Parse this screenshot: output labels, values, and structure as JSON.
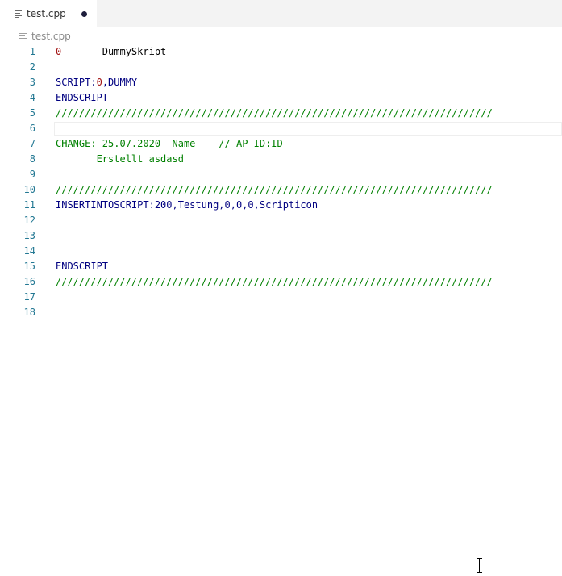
{
  "tab": {
    "label": "test.cpp",
    "file_icon": "file-lines-icon",
    "dirty_indicator": "unsaved-dot"
  },
  "breadcrumb": {
    "label": "test.cpp",
    "icon": "file-lines-icon"
  },
  "colors": {
    "line_number": "#237893",
    "keyword": "#000080",
    "comment": "#008000",
    "number": "#a31515"
  },
  "editor": {
    "current_line": 6,
    "lines": [
      {
        "n": "1",
        "tokens": [
          {
            "t": "0",
            "c": "num"
          },
          {
            "t": "       DummySkript",
            "c": "plain"
          }
        ]
      },
      {
        "n": "2",
        "tokens": []
      },
      {
        "n": "3",
        "tokens": [
          {
            "t": "SCRIPT:",
            "c": "kw"
          },
          {
            "t": "0",
            "c": "num"
          },
          {
            "t": ",DUMMY",
            "c": "kw"
          }
        ]
      },
      {
        "n": "4",
        "tokens": [
          {
            "t": "ENDSCRIPT",
            "c": "kw"
          }
        ]
      },
      {
        "n": "5",
        "tokens": [
          {
            "t": "///////////////////////////////////////////////////////////////////////////",
            "c": "com"
          }
        ]
      },
      {
        "n": "6",
        "tokens": []
      },
      {
        "n": "7",
        "tokens": [
          {
            "t": "CHANGE: 25.07.2020  Name    // AP-ID:ID",
            "c": "com"
          }
        ]
      },
      {
        "n": "8",
        "tokens": [
          {
            "t": "       Erstellt asdasd",
            "c": "com"
          }
        ]
      },
      {
        "n": "9",
        "tokens": []
      },
      {
        "n": "10",
        "tokens": [
          {
            "t": "///////////////////////////////////////////////////////////////////////////",
            "c": "com"
          }
        ]
      },
      {
        "n": "11",
        "tokens": [
          {
            "t": "INSERTINTOSCRIPT:200,Testung,0,0,0,Scripticon",
            "c": "kw"
          }
        ]
      },
      {
        "n": "12",
        "tokens": []
      },
      {
        "n": "13",
        "tokens": []
      },
      {
        "n": "14",
        "tokens": []
      },
      {
        "n": "15",
        "tokens": [
          {
            "t": "ENDSCRIPT",
            "c": "kw"
          }
        ]
      },
      {
        "n": "16",
        "tokens": [
          {
            "t": "///////////////////////////////////////////////////////////////////////////",
            "c": "com"
          }
        ]
      },
      {
        "n": "17",
        "tokens": []
      },
      {
        "n": "18",
        "tokens": []
      }
    ]
  },
  "mouse_cursor": "text-ibeam-cursor"
}
